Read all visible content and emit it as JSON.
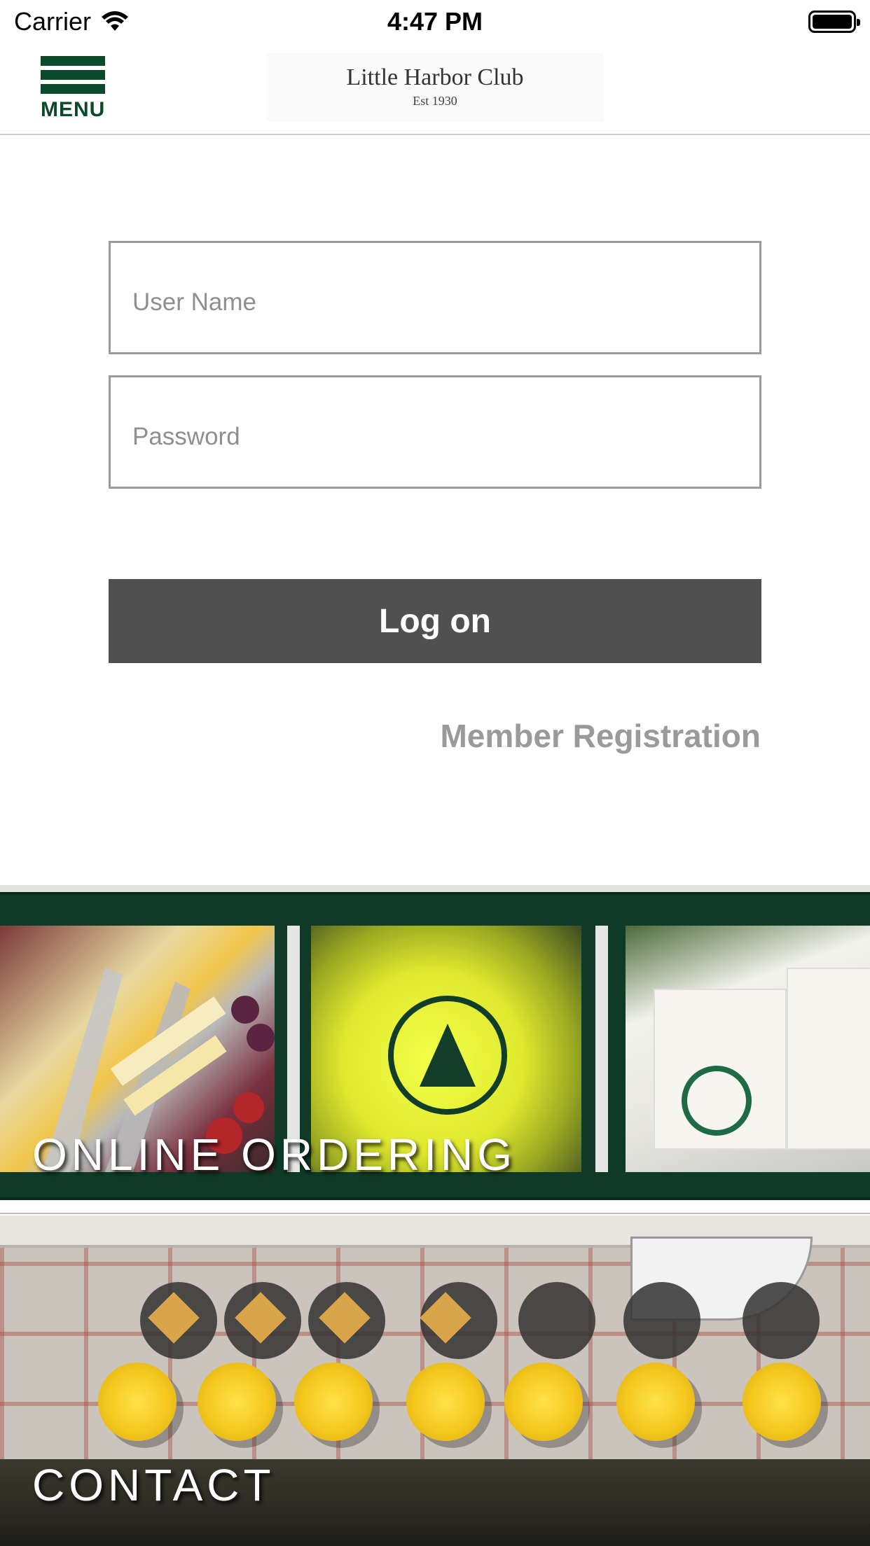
{
  "status_bar": {
    "carrier": "Carrier",
    "time": "4:47 PM"
  },
  "header": {
    "menu_label": "MENU",
    "logo_title": "Little Harbor Club",
    "logo_subtitle": "Est 1930"
  },
  "login": {
    "username_placeholder": "User Name",
    "username_value": "",
    "password_placeholder": "Password",
    "password_value": "",
    "logon_label": "Log on",
    "register_label": "Member Registration"
  },
  "tiles": [
    {
      "label": "ONLINE ORDERING"
    },
    {
      "label": "CONTACT"
    }
  ],
  "colors": {
    "brand_green": "#0b4a2a",
    "button_gray": "#505050",
    "link_gray": "#9a9a9a"
  }
}
